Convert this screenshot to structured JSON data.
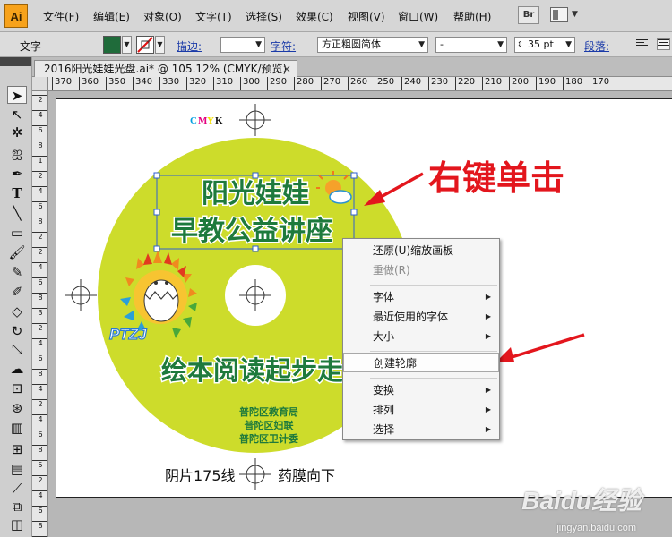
{
  "app": {
    "logo": "Ai",
    "menus": [
      "文件(F)",
      "编辑(E)",
      "对象(O)",
      "文字(T)",
      "选择(S)",
      "效果(C)",
      "视图(V)",
      "窗口(W)",
      "帮助(H)"
    ],
    "bridge_label": "Br"
  },
  "control_bar": {
    "tool_label": "文字",
    "fill_color": "#1f6b3a",
    "stroke_label": "描边:",
    "char_label": "字符:",
    "font_family": "方正粗圆简体",
    "font_style": "-",
    "font_size": "35 pt",
    "para_label": "段落:"
  },
  "document": {
    "tab_title": "2016阳光娃娃光盘.ai* @ 105.12% (CMYK/预览)",
    "close_glyph": "×"
  },
  "rulers": {
    "h_ticks": [
      "370",
      "360",
      "350",
      "340",
      "330",
      "320",
      "310",
      "300",
      "290",
      "280",
      "270",
      "260",
      "250",
      "240",
      "230",
      "220",
      "210",
      "200",
      "190",
      "180",
      "170"
    ],
    "v_ticks": [
      "2",
      "4",
      "6",
      "8",
      "1",
      "2",
      "4",
      "6",
      "8",
      "2",
      "2",
      "4",
      "6",
      "8",
      "3",
      "2",
      "4",
      "6",
      "8",
      "4",
      "2",
      "4",
      "6",
      "8",
      "5",
      "2",
      "4",
      "6",
      "8",
      "6"
    ]
  },
  "artwork": {
    "cmyk_c": "C",
    "cmyk_m": "M",
    "cmyk_y": "Y",
    "cmyk_k": "K",
    "title_line1": "阳光娃娃",
    "title_line2": "早教公益讲座",
    "logo_text": "PTZJ",
    "subtitle": "绘本阅读起步走",
    "org_1": "普陀区教育局",
    "org_2": "普陀区妇联",
    "org_3": "普陀区卫计委",
    "bottom_left": "阴片175线",
    "bottom_right": "药膜向下",
    "disc_color": "#cddc2b",
    "text_color": "#1e7a3c"
  },
  "context_menu": {
    "items": [
      {
        "label": "还原(U)缩放画板",
        "disabled": false,
        "submenu": false
      },
      {
        "label": "重做(R)",
        "disabled": true,
        "submenu": false
      },
      {
        "label": "字体",
        "disabled": false,
        "submenu": true
      },
      {
        "label": "最近使用的字体",
        "disabled": false,
        "submenu": true
      },
      {
        "label": "大小",
        "disabled": false,
        "submenu": true
      },
      {
        "label": "创建轮廓",
        "disabled": false,
        "submenu": false
      },
      {
        "label": "变换",
        "disabled": false,
        "submenu": true
      },
      {
        "label": "排列",
        "disabled": false,
        "submenu": true
      },
      {
        "label": "选择",
        "disabled": false,
        "submenu": true
      }
    ]
  },
  "annotation": {
    "text": "右键单击",
    "color": "#e3161d"
  },
  "watermark": {
    "brand": "Baidu经验",
    "url": "jingyan.baidu.com"
  }
}
